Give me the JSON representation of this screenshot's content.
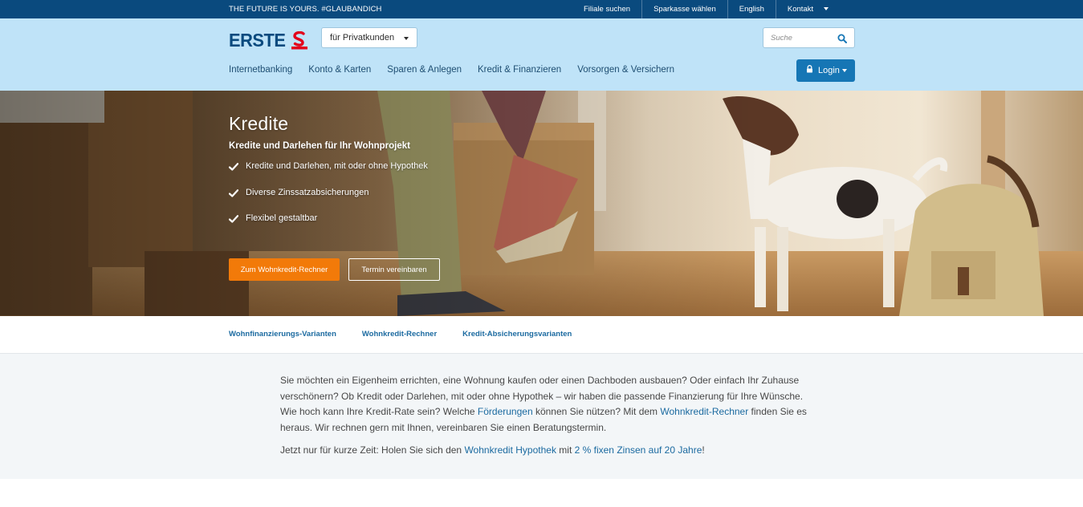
{
  "topbar": {
    "slogan": "THE FUTURE IS YOURS. #GLAUBANDICH",
    "links": [
      "Filiale suchen",
      "Sparkasse wählen",
      "English",
      "Kontakt"
    ]
  },
  "header": {
    "logo_text": "ERSTE",
    "segment_label": "für Privatkunden",
    "search_placeholder": "Suche",
    "nav": [
      "Internetbanking",
      "Konto & Karten",
      "Sparen & Anlegen",
      "Kredit & Finanzieren",
      "Vorsorgen & Versichern"
    ],
    "login_label": "Login"
  },
  "hero": {
    "title": "Kredite",
    "subtitle": "Kredite und Darlehen für Ihr Wohnprojekt",
    "bullets": [
      "Kredite und Darlehen, mit oder ohne Hypothek",
      "Diverse Zinssatzabsicherungen",
      "Flexibel gestaltbar"
    ],
    "primary_button": "Zum Wohnkredit-Rechner",
    "secondary_button": "Termin vereinbaren"
  },
  "subnav": {
    "links": [
      "Wohnfinanzierungs-Varianten",
      "Wohnkredit-Rechner",
      "Kredit-Absicherungsvarianten"
    ]
  },
  "intro": {
    "p1_part1": "Sie möchten ein Eigenheim errichten, eine Wohnung kaufen oder einen Dachboden ausbauen? Oder einfach Ihr Zuhause verschönern? Ob Kredit oder Darlehen, mit oder ohne Hypothek – wir haben die passende Finanzierung für Ihre Wünsche. Wie hoch kann Ihre Kredit-Rate sein? Welche ",
    "p1_link1": "Förderungen",
    "p1_part2": " können Sie nützen? Mit dem ",
    "p1_link2": "Wohnkredit-Rechner",
    "p1_part3": " finden Sie es heraus. Wir rechnen gern mit Ihnen, vereinbaren Sie einen Beratungstermin.",
    "p2_part1": "Jetzt nur für kurze Zeit: Holen Sie sich den ",
    "p2_link1": "Wohnkredit Hypothek",
    "p2_part2": " mit ",
    "p2_link2": "2 % fixen Zinsen auf 20 Jahre",
    "p2_part3": "!"
  },
  "colors": {
    "topbar_bg": "#0a4a7e",
    "header_bg": "#bfe3f8",
    "login_bg": "#1676b5",
    "cta_orange": "#f27a09",
    "link_blue": "#1b6aa0",
    "logo_red": "#e3001b"
  },
  "icons": [
    "erste-s-logo-icon",
    "search-icon",
    "lock-icon",
    "chevron-down-icon",
    "checkmark-icon"
  ]
}
